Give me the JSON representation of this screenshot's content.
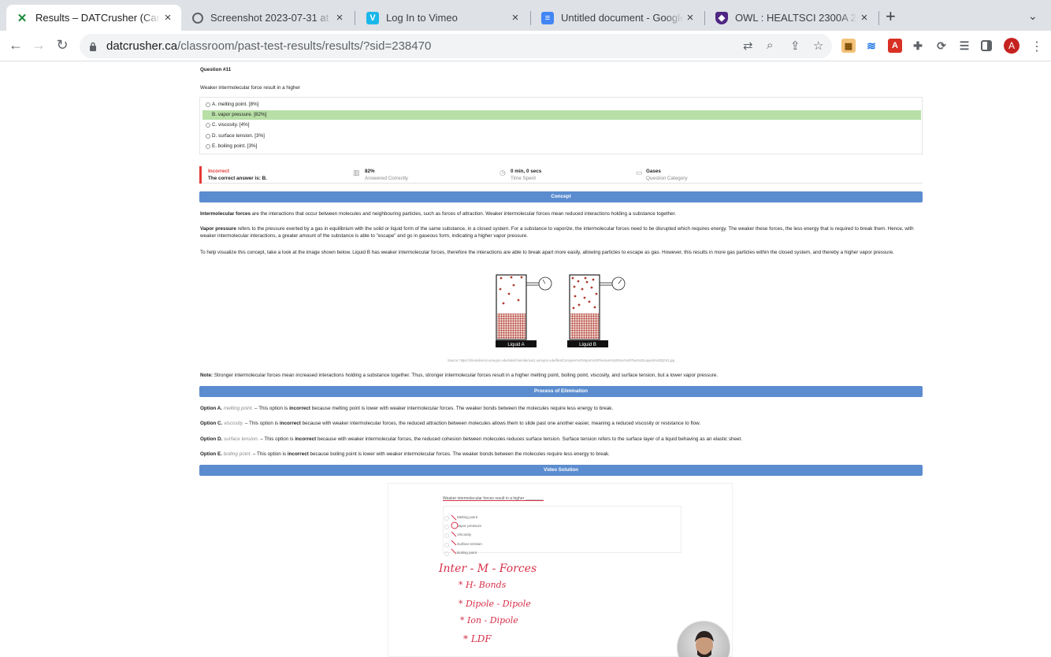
{
  "browser": {
    "tabs": [
      {
        "title": "Results – DATCrusher (Canadian",
        "icon": "datcrusher-x-icon",
        "active": true
      },
      {
        "title": "Screenshot 2023-07-31 at 5.0",
        "icon": "globe-icon",
        "active": false
      },
      {
        "title": "Log In to Vimeo",
        "icon": "vimeo-icon",
        "active": false
      },
      {
        "title": "Untitled document - Google Do",
        "icon": "google-docs-icon",
        "active": false
      },
      {
        "title": "OWL : HEALTSCI 2300A 200 S",
        "icon": "owl-shield-icon",
        "active": false
      }
    ],
    "new_tab_label": "+",
    "url_host": "datcrusher.ca",
    "url_path": "/classroom/past-test-results/results/?sid=238470",
    "avatar_letter": "A",
    "accent": "#c5221f"
  },
  "question": {
    "number_label": "Question #11",
    "text": "Weaker intermolecular force result in a higher",
    "choices": [
      {
        "label": "A. melting point. [8%]",
        "selected": false
      },
      {
        "label": "B. vapor pressure. [82%]",
        "selected": true
      },
      {
        "label": "C. viscosity. [4%]",
        "selected": false
      },
      {
        "label": "D. surface tension. [3%]",
        "selected": false
      },
      {
        "label": "E. boiling point. [3%]",
        "selected": false
      }
    ],
    "highlight_color": "#b7dfa6"
  },
  "stats": {
    "status": "Incorrect",
    "correct_answer": "The correct answer is: B.",
    "percent": "82%",
    "percent_label": "Answered Correctly",
    "time": "0 min, 0 secs",
    "time_label": "Time Spent",
    "category": "Gases",
    "category_label": "Question Category",
    "status_color": "#e53935"
  },
  "sections": {
    "concept": "Concept",
    "elimination": "Process of Elimination",
    "video": "Video Solution",
    "band_color": "#5b8ccf"
  },
  "concept": {
    "p1_bold": "Intermolecular forces",
    "p1_rest": " are the interactions that occur between molecules and neighbouring particles, such as forces of attraction. Weaker intermolecular forces mean reduced interactions holding a substance together.",
    "p2_bold": "Vapor pressure",
    "p2_rest": " refers to the pressure exerted by a gas in equilibrium with the solid or liquid form of the same substance, in a closed system. For a substance to vaporize, the intermolecular forces need to be disrupted which requires energy. The weaker these forces, the less energy that is required to break them. Hence, with weaker intermolecular interactions, a greater amount of the substance is able to \"escape\" and go in gaseous form, indicating a higher vapor pressure.",
    "p3": "To help visualize this concept, take a look at the image shown below. Liquid B has weaker intermolecular forces, therefore the interactions are able to break apart more easily, allowing particles to escape as gas. However, this results in more gas particles within the closed system, and thereby a higher vapor pressure.",
    "liquid_a": "Liquid A",
    "liquid_b": "Liquid B",
    "source": "Source: https://chemdemos.uoregon.edu/sites/chemdemos1.uoregon.edu/files/Compare%20Vapor%20Pressure%20Over%20Two%20Liquids%20Q041.jpg",
    "note_bold": "Note:",
    "note_rest": " Stronger intermolecular forces mean increased interactions holding a substance together. Thus, stronger intermolecular forces result in a higher melting point, boiling point, viscosity, and surface tension, but a lower vapor pressure."
  },
  "elimination": [
    {
      "option": "Option A.",
      "choice": "melting point.",
      "pre": " – This option is ",
      "verdict": "incorrect",
      "post": " because melting point is lower with weaker intermolecular forces. The weaker bonds between the molecules require less energy to break."
    },
    {
      "option": "Option C.",
      "choice": "viscosity.",
      "pre": " – This option is ",
      "verdict": "incorrect",
      "post": " because with weaker intermolecular forces, the reduced attraction between molecules allows them to slide past one another easier, meaning a reduced viscosity or resistance to flow."
    },
    {
      "option": "Option D.",
      "choice": "surface tension.",
      "pre": " – This option is ",
      "verdict": "incorrect",
      "post": " because with weaker intermolecular forces, the reduced cohesion between molecules reduces surface tension. Surface tension refers to the surface layer of a liquid behaving as an elastic sheet."
    },
    {
      "option": "Option E.",
      "choice": "boiling point.",
      "pre": " – This option is ",
      "verdict": "incorrect",
      "post": " because boiling point is lower with weaker intermolecular forces. The weaker bonds between the molecules require less energy to break."
    }
  ],
  "video": {
    "question": "Weaker intermolecular forces result in a higher ________.",
    "options": [
      "Melting point",
      "Vapor pressure",
      "Viscosity",
      "Surface tension",
      "Boiling point"
    ],
    "notes": [
      "Inter - M - Forces",
      "* H- Bonds",
      "* Dipole - Dipole",
      "* Ion - Dipole",
      "* LDF"
    ]
  }
}
